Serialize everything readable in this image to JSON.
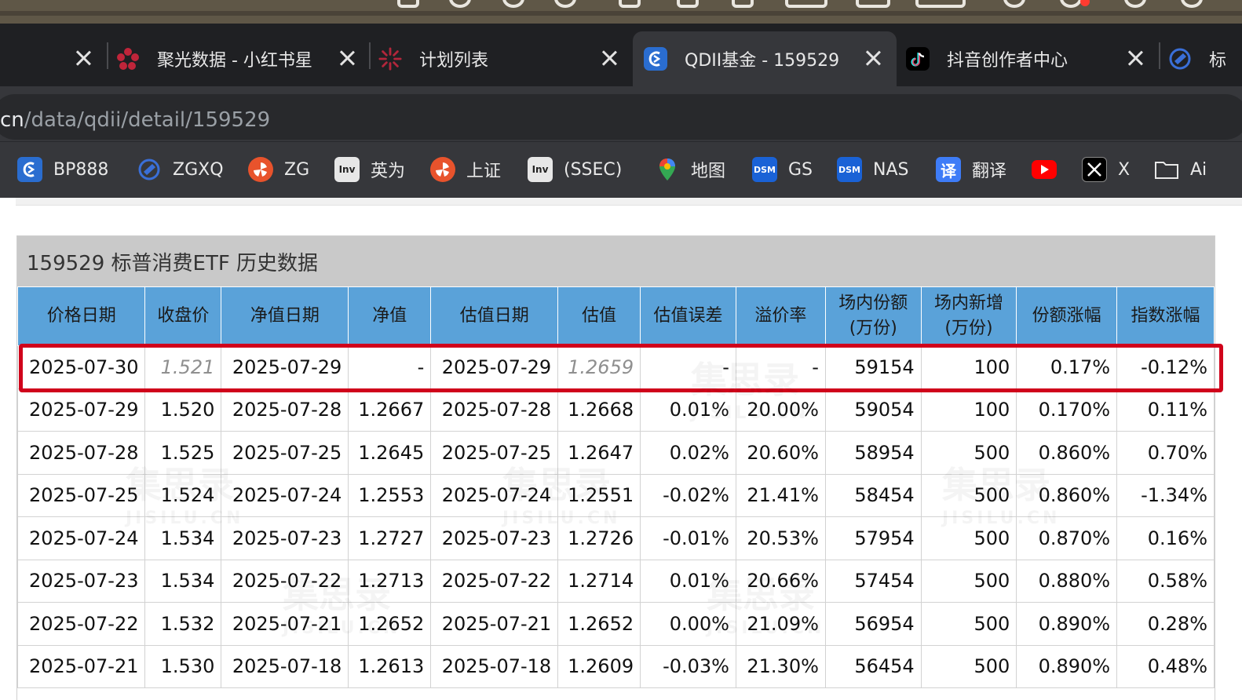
{
  "browser": {
    "tabs": [
      {
        "title": "",
        "icon": "none",
        "active": false
      },
      {
        "title": "聚光数据 - 小红书星",
        "icon": "red-flower-icon",
        "active": false
      },
      {
        "title": "计划列表",
        "icon": "red-sparkle-icon",
        "active": false
      },
      {
        "title": "QDII基金 - 159529",
        "icon": "jisilu-icon",
        "active": true
      },
      {
        "title": "抖音创作者中心",
        "icon": "tiktok-icon",
        "active": false
      },
      {
        "title": "标",
        "icon": "jisilu-icon",
        "active": false
      }
    ],
    "url_host": "cn",
    "url_path": "/data/qdii/detail/159529",
    "bookmarks": [
      {
        "label": "BP888",
        "icon": "jisilu-icon"
      },
      {
        "label": "ZGXQ",
        "icon": "swirl-icon"
      },
      {
        "label": "ZG",
        "icon": "orange-fan-icon"
      },
      {
        "label": "英为",
        "icon": "investing-icon",
        "badge": "Inv"
      },
      {
        "label": "上证",
        "icon": "orange-fan-icon"
      },
      {
        "label": "(SSEC)",
        "icon": "investing-icon",
        "badge": "Inv"
      },
      {
        "label": "地图",
        "icon": "map-pin-icon"
      },
      {
        "label": "GS",
        "icon": "dsm-icon",
        "badge": "DSM"
      },
      {
        "label": "NAS",
        "icon": "dsm-icon",
        "badge": "DSM"
      },
      {
        "label": "翻译",
        "icon": "translate-icon",
        "badge": "译"
      },
      {
        "label": "",
        "icon": "youtube-icon"
      },
      {
        "label": "X",
        "icon": "x-icon"
      },
      {
        "label": "Ai",
        "icon": "folder-icon"
      }
    ]
  },
  "table": {
    "caption": "159529 标普消费ETF 历史数据",
    "headers": [
      "价格日期",
      "收盘价",
      "净值日期",
      "净值",
      "估值日期",
      "估值",
      "估值误差",
      "溢价率",
      "场内份额\n(万份)",
      "场内新增\n(万份)",
      "份额涨幅",
      "指数涨幅"
    ],
    "rows": [
      [
        "2025-07-30",
        "1.521",
        "2025-07-29",
        "-",
        "2025-07-29",
        "1.2659",
        "-",
        "-",
        "59154",
        "100",
        "0.17%",
        "-0.12%"
      ],
      [
        "2025-07-29",
        "1.520",
        "2025-07-28",
        "1.2667",
        "2025-07-28",
        "1.2668",
        "0.01%",
        "20.00%",
        "59054",
        "100",
        "0.170%",
        "0.11%"
      ],
      [
        "2025-07-28",
        "1.525",
        "2025-07-25",
        "1.2645",
        "2025-07-25",
        "1.2647",
        "0.02%",
        "20.60%",
        "58954",
        "500",
        "0.860%",
        "0.70%"
      ],
      [
        "2025-07-25",
        "1.524",
        "2025-07-24",
        "1.2553",
        "2025-07-24",
        "1.2551",
        "-0.02%",
        "21.41%",
        "58454",
        "500",
        "0.860%",
        "-1.34%"
      ],
      [
        "2025-07-24",
        "1.534",
        "2025-07-23",
        "1.2727",
        "2025-07-23",
        "1.2726",
        "-0.01%",
        "20.53%",
        "57954",
        "500",
        "0.870%",
        "0.16%"
      ],
      [
        "2025-07-23",
        "1.534",
        "2025-07-22",
        "1.2713",
        "2025-07-22",
        "1.2714",
        "0.01%",
        "20.66%",
        "57454",
        "500",
        "0.880%",
        "0.58%"
      ],
      [
        "2025-07-22",
        "1.532",
        "2025-07-21",
        "1.2652",
        "2025-07-21",
        "1.2652",
        "0.00%",
        "21.09%",
        "56954",
        "500",
        "0.890%",
        "0.28%"
      ],
      [
        "2025-07-21",
        "1.530",
        "2025-07-18",
        "1.2613",
        "2025-07-18",
        "1.2609",
        "-0.03%",
        "21.30%",
        "56454",
        "500",
        "0.890%",
        "0.48%"
      ]
    ],
    "highlighted_row": 0,
    "estimate_row": 0
  },
  "watermark": {
    "title": "集思录",
    "sub": "JISILU.CN"
  },
  "colors": {
    "header_bg": "#5aa2d9",
    "caption_bg": "#c9c9c9",
    "highlight": "#d0021b",
    "tab_bg": "#1f2023",
    "toolbar_bg": "#36373b"
  }
}
